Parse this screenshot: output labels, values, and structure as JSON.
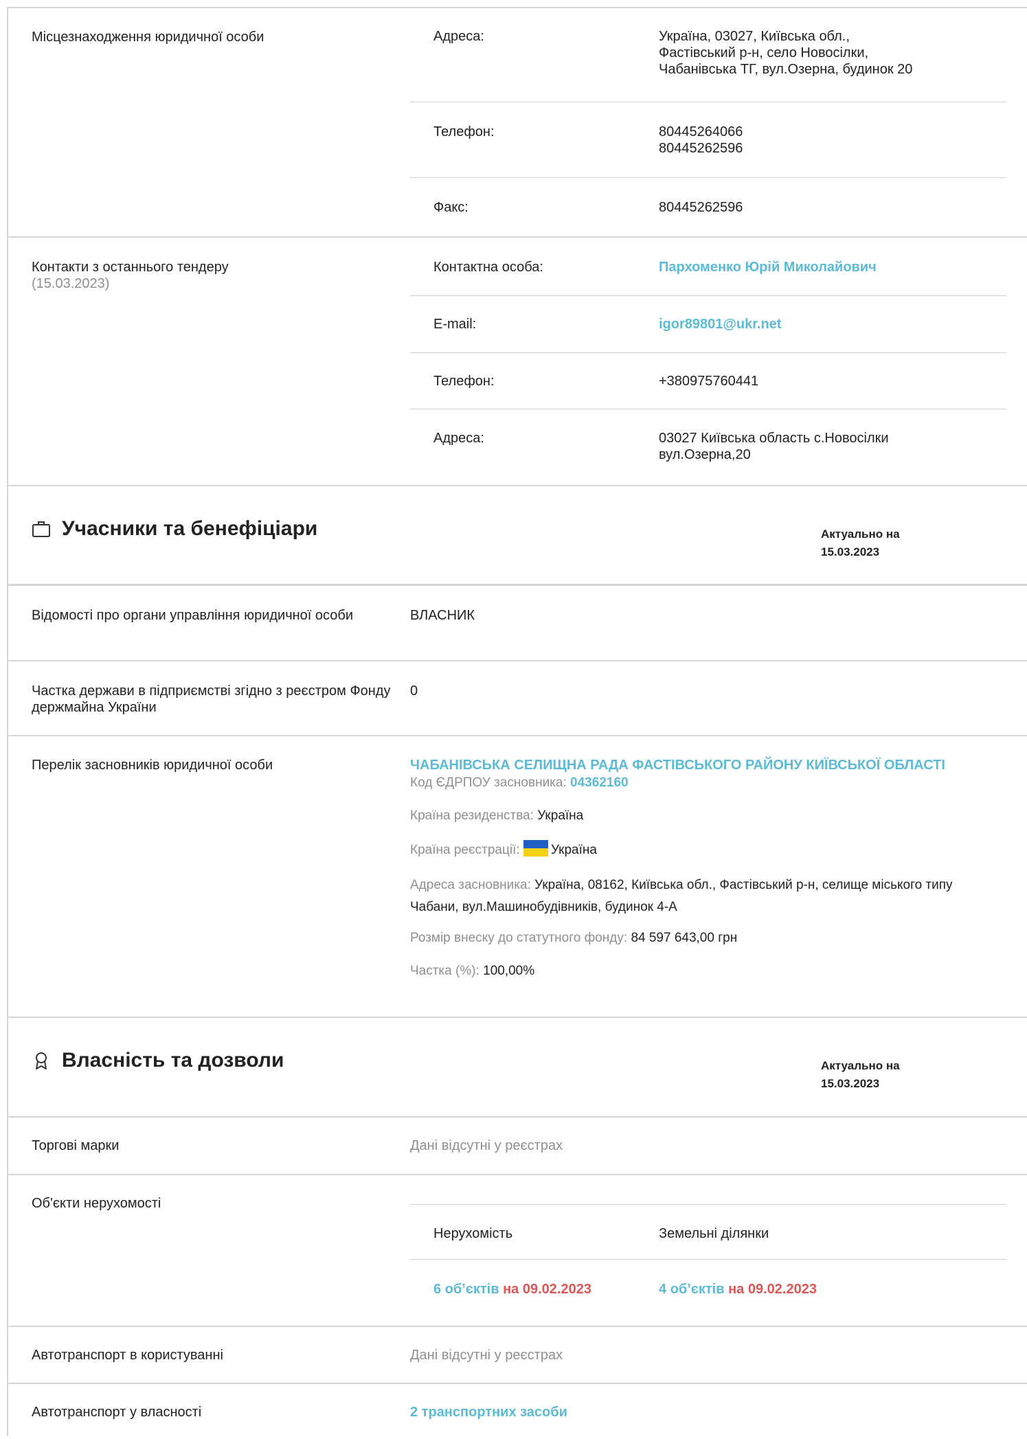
{
  "location": {
    "label": "Місцезнаходження юридичної особи",
    "rows": [
      {
        "key": "Адреса:",
        "value": [
          "Україна, 03027, Київська обл.,",
          "Фастівський р-н, село Новосілки,",
          "Чабанівська ТГ, вул.Озерна, будинок 20"
        ]
      },
      {
        "key": "Телефон:",
        "value": [
          "80445264066",
          "80445262596"
        ]
      },
      {
        "key": "Факс:",
        "value": [
          "80445262596"
        ]
      }
    ]
  },
  "contacts": {
    "label": "Контакти з останнього тендеру",
    "date": "(15.03.2023)",
    "person_key": "Контактна особа:",
    "person": "Пархоменко Юрій Миколайович",
    "email_key": "E-mail:",
    "email": "igor89801@ukr.net",
    "phone_key": "Телефон:",
    "phone": "+380975760441",
    "address_key": "Адреса:",
    "address_1": "03027 Київська область с.Новосілки",
    "address_2": "вул.Озерна,20"
  },
  "participants": {
    "title": "Учасники та бенефіціари",
    "icon": "briefcase-icon",
    "date_label": "Актуально на",
    "date": "15.03.2023",
    "governance_label": "Відомості про органи управління юридичної особи",
    "governance_value": "ВЛАСНИК",
    "state_share_label": "Частка держави в підприємстві згідно з реєстром Фонду держмайна України",
    "state_share_value": "0",
    "founders_label": "Перелік засновників юридичної особи",
    "founder": {
      "name": "ЧАБАНІВСЬКА СЕЛИЩНА РАДА ФАСТІВСЬКОГО РАЙОНУ КИЇВСЬКОЇ ОБЛАСТІ",
      "code_key": "Код ЄДРПОУ засновника:",
      "code": "04362160",
      "residence_key": "Країна резиденства:",
      "residence": "Україна",
      "registration_key": "Країна реєстрації:",
      "registration": "Україна",
      "address_key": "Адреса засновника:",
      "address": "Україна, 08162, Київська обл., Фастівський р-н, селище міського типу Чабани, вул.Машинобудівників, будинок 4-А",
      "contribution_key": "Розмір внеску до статутного фонду:",
      "contribution": "84 597 643,00 грн",
      "share_key": "Частка (%):",
      "share": "100,00%"
    }
  },
  "property": {
    "title": "Власність та дозволи",
    "icon": "award-icon",
    "date_label": "Актуально на",
    "date": "15.03.2023",
    "trademarks_label": "Торгові марки",
    "trademarks_value": "Дані відсутні у реєстрах",
    "realty_label": "Об'єкти нерухомості",
    "realty_head_1": "Нерухомість",
    "realty_head_2": "Земельні ділянки",
    "realty_count_1": "6 об’єктів",
    "realty_date_1": "на 09.02.2023",
    "realty_count_2": "4 об’єктів",
    "realty_date_2": "на 09.02.2023",
    "vehicles_use_label": "Автотранспорт в користуванні",
    "vehicles_use_value": "Дані відсутні у реєстрах",
    "vehicles_own_label": "Автотранспорт у власності",
    "vehicles_own_value": "2 транспортних засоби"
  },
  "colors": {
    "link": "#5bbbd6",
    "accent_red": "#e05555",
    "muted": "#8f8f8f"
  }
}
